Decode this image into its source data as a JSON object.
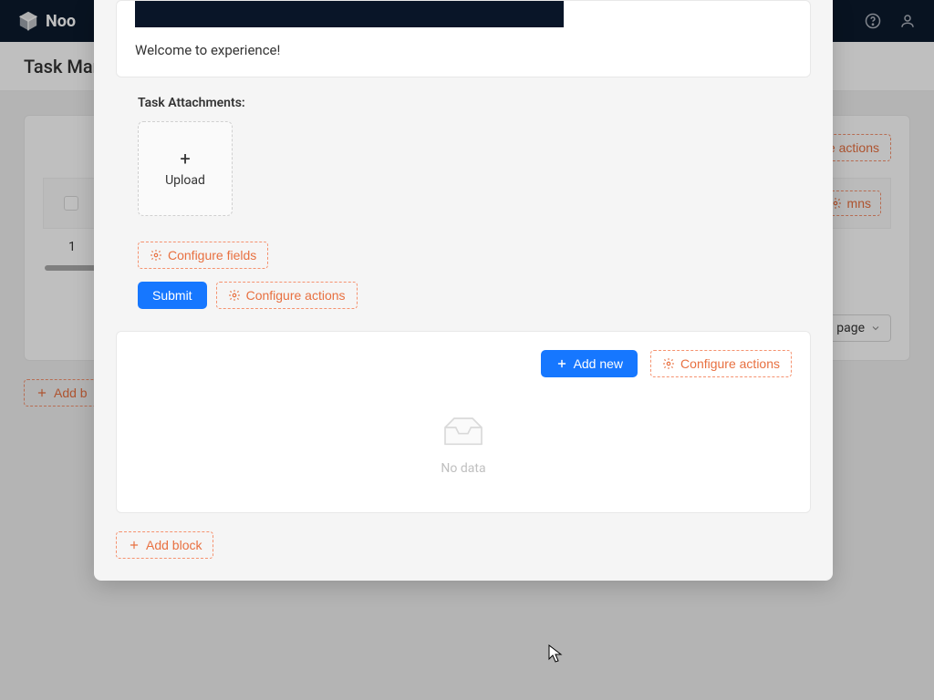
{
  "app": {
    "brand": "Noo"
  },
  "page": {
    "title": "Task Mar"
  },
  "bg": {
    "configure_actions": "e actions",
    "configure_columns": "mns",
    "row_number": "1",
    "pager_label": "page",
    "add_block": "Add b"
  },
  "modal": {
    "card1": {
      "welcome": "Welcome to experience!",
      "attachments_label": "Task Attachments:",
      "upload": "Upload",
      "configure_fields": "Configure fields",
      "submit": "Submit",
      "configure_actions": "Configure actions"
    },
    "card2": {
      "add_new": "Add new",
      "configure_actions": "Configure actions",
      "no_data": "No data"
    },
    "add_block": "Add block"
  }
}
